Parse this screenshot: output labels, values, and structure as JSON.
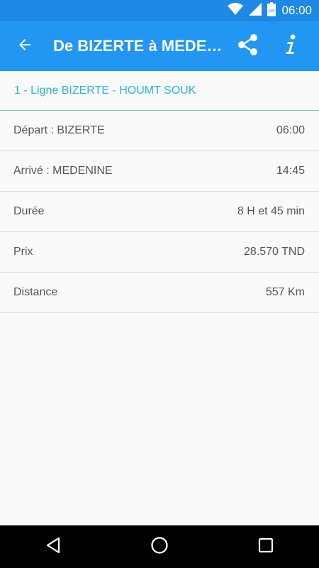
{
  "status_bar": {
    "time": "06:00",
    "battery": "100",
    "icons": [
      "wifi-icon",
      "signal-icon",
      "battery-icon"
    ]
  },
  "toolbar": {
    "title": "De BIZERTE à MEDENINE",
    "icons": [
      "back-arrow-icon",
      "share-icon",
      "info-icon"
    ]
  },
  "line": {
    "label": "1 - Ligne BIZERTE - HOUMT SOUK"
  },
  "details": [
    {
      "label": "Départ : BIZERTE",
      "value": "06:00"
    },
    {
      "label": "Arrivé : MEDENINE",
      "value": "14:45"
    },
    {
      "label": "Durée",
      "value": "8 H et 45 min"
    },
    {
      "label": "Prix",
      "value": "28.570 TND"
    },
    {
      "label": "Distance",
      "value": "557 Km"
    }
  ],
  "nav_bar": {
    "icons": [
      "back-triangle-icon",
      "home-circle-icon",
      "recents-square-icon"
    ]
  },
  "colors": {
    "status_bar": "#1e88e5",
    "toolbar": "#2196f3",
    "line_text": "#29b6d6",
    "background": "#fafafa"
  }
}
